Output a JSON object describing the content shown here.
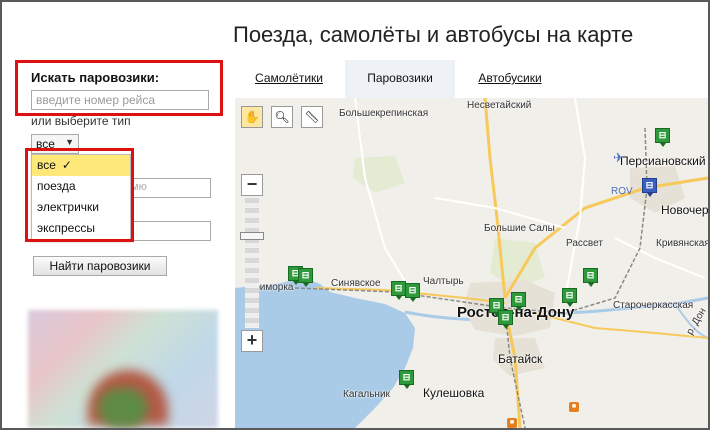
{
  "page": {
    "title": "Поезда, самолёты и автобусы на карте"
  },
  "tabs": [
    {
      "label": "Самолётики",
      "active": false
    },
    {
      "label": "Паровозики",
      "active": true
    },
    {
      "label": "Автобусики",
      "active": false
    }
  ],
  "sidebar": {
    "search_label": "Искать паровозики:",
    "search_placeholder": "введите номер рейса",
    "type_label": "или выберите тип",
    "type_selected": "все",
    "type_options": [
      {
        "label": "все",
        "selected": true
      },
      {
        "label": "поезда",
        "selected": false
      },
      {
        "label": "электрички",
        "selected": false
      },
      {
        "label": "экспрессы",
        "selected": false
      }
    ],
    "partial_field_text": "мю",
    "find_button": "Найти паровозики"
  },
  "map": {
    "places": [
      "Несветайский",
      "Большекрепинская",
      "Персиановский",
      "ROV",
      "Новочеркасск",
      "Кривянская",
      "Большие Салы",
      "Рассвет",
      "Синявское",
      "Чалтырь",
      "Приморка",
      "Ростов-на-Дону",
      "Старочеркасская",
      "Батайск",
      "Кулешовка",
      "Кагальник",
      "р. Дон"
    ],
    "colors": {
      "water": "#a9cbe8",
      "land": "#f1efe9",
      "road": "#f7c95a",
      "marker": "#2f9a3b"
    }
  }
}
